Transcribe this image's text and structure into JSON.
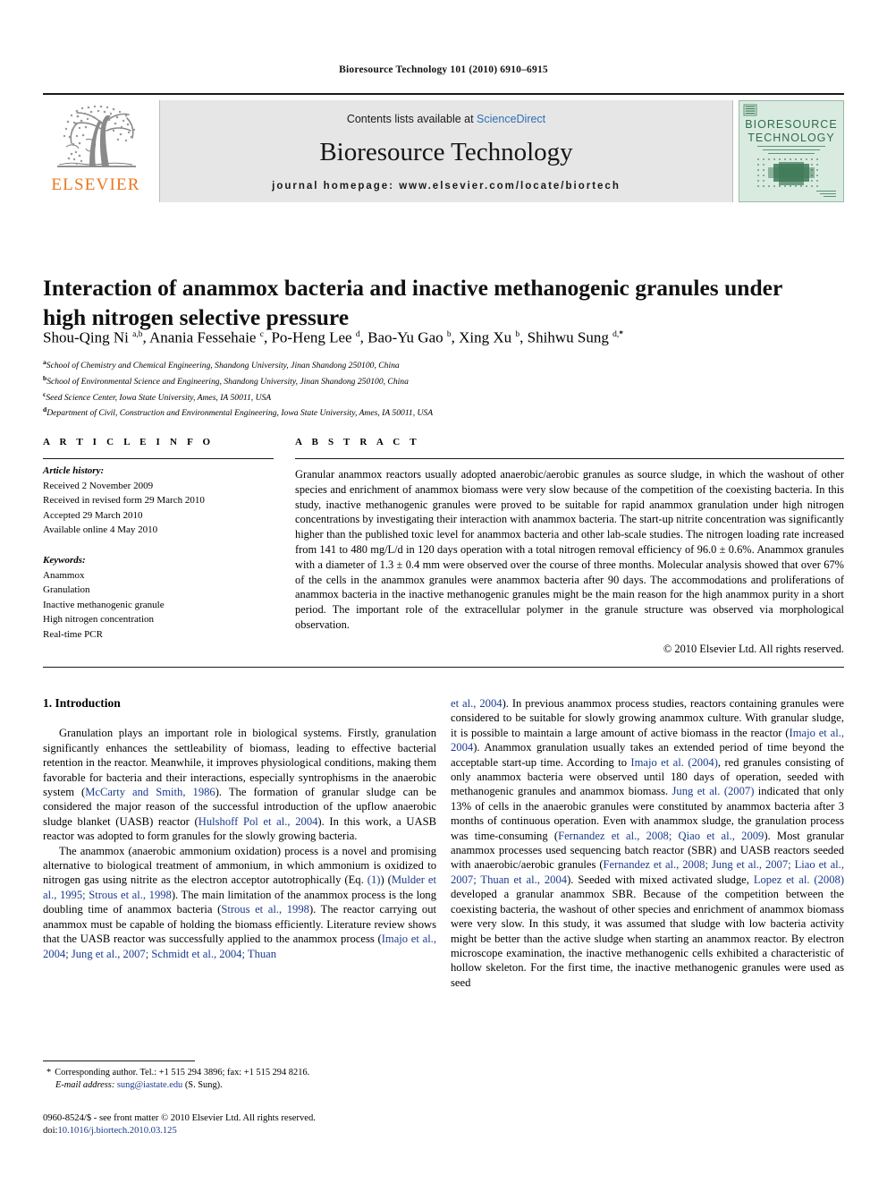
{
  "running_head": "Bioresource Technology 101 (2010) 6910–6915",
  "masthead": {
    "publisher_name": "ELSEVIER",
    "contents_prefix": "Contents lists available at ",
    "contents_link": "ScienceDirect",
    "journal_name": "Bioresource Technology",
    "homepage": "journal homepage: www.elsevier.com/locate/biortech",
    "cover_line1": "BIORESOURCE",
    "cover_line2": "TECHNOLOGY"
  },
  "article": {
    "title": "Interaction of anammox bacteria and inactive methanogenic granules under high nitrogen selective pressure",
    "authors_html": "Shou-Qing Ni <sup>a,b</sup>, Anania Fessehaie <sup>c</sup>, Po-Heng Lee <sup>d</sup>, Bao-Yu Gao <sup>b</sup>, Xing Xu <sup>b</sup>, Shihwu Sung <sup>d,<b>*</b></sup>",
    "affiliations": [
      {
        "marker": "a",
        "text": "School of Chemistry and Chemical Engineering, Shandong University, Jinan Shandong 250100, China"
      },
      {
        "marker": "b",
        "text": "School of Environmental Science and Engineering, Shandong University, Jinan Shandong 250100, China"
      },
      {
        "marker": "c",
        "text": "Seed Science Center, Iowa State University, Ames, IA 50011, USA"
      },
      {
        "marker": "d",
        "text": "Department of Civil, Construction and Environmental Engineering, Iowa State University, Ames, IA 50011, USA"
      }
    ]
  },
  "article_info": {
    "heading": "A R T I C L E   I N F O",
    "history_label": "Article history:",
    "history": [
      "Received 2 November 2009",
      "Received in revised form 29 March 2010",
      "Accepted 29 March 2010",
      "Available online 4 May 2010"
    ],
    "keywords_label": "Keywords:",
    "keywords": [
      "Anammox",
      "Granulation",
      "Inactive methanogenic granule",
      "High nitrogen concentration",
      "Real-time PCR"
    ]
  },
  "abstract": {
    "heading": "A B S T R A C T",
    "text": "Granular anammox reactors usually adopted anaerobic/aerobic granules as source sludge, in which the washout of other species and enrichment of anammox biomass were very slow because of the competition of the coexisting bacteria. In this study, inactive methanogenic granules were proved to be suitable for rapid anammox granulation under high nitrogen concentrations by investigating their interaction with anammox bacteria. The start-up nitrite concentration was significantly higher than the published toxic level for anammox bacteria and other lab-scale studies. The nitrogen loading rate increased from 141 to 480 mg/L/d in 120 days operation with a total nitrogen removal efficiency of 96.0 ± 0.6%. Anammox granules with a diameter of 1.3 ± 0.4 mm were observed over the course of three months. Molecular analysis showed that over 67% of the cells in the anammox granules were anammox bacteria after 90 days. The accommodations and proliferations of anammox bacteria in the inactive methanogenic granules might be the main reason for the high anammox purity in a short period. The important role of the extracellular polymer in the granule structure was observed via morphological observation.",
    "copyright": "© 2010 Elsevier Ltd. All rights reserved."
  },
  "body": {
    "section_number_title": "1. Introduction",
    "left_paragraphs_html": [
      "Granulation plays an important role in biological systems. Firstly, granulation significantly enhances the settleability of biomass, leading to effective bacterial retention in the reactor. Meanwhile, it improves physiological conditions, making them favorable for bacteria and their interactions, especially syntrophisms in the anaerobic system (<a class=\"ref\">McCarty and Smith, 1986</a>). The formation of granular sludge can be considered the major reason of the successful introduction of the upflow anaerobic sludge blanket (UASB) reactor (<a class=\"ref\">Hulshoff Pol et al., 2004</a>). In this work, a UASB reactor was adopted to form granules for the slowly growing bacteria.",
      "The anammox (anaerobic ammonium oxidation) process is a novel and promising alternative to biological treatment of ammonium, in which ammonium is oxidized to nitrogen gas using nitrite as the electron acceptor autotrophically (Eq. <a class=\"ref\">(1)</a>) (<a class=\"ref\">Mulder et al., 1995; Strous et al., 1998</a>). The main limitation of the anammox process is the long doubling time of anammox bacteria (<a class=\"ref\">Strous et al., 1998</a>). The reactor carrying out anammox must be capable of holding the biomass efficiently. Literature review shows that the UASB reactor was successfully applied to the anammox process (<a class=\"ref\">Imajo et al., 2004; Jung et al., 2007; Schmidt et al., 2004; Thuan</a>"
    ],
    "right_paragraphs_html": [
      "<a class=\"ref\">et al., 2004</a>). In previous anammox process studies, reactors containing granules were considered to be suitable for slowly growing anammox culture. With granular sludge, it is possible to maintain a large amount of active biomass in the reactor (<a class=\"ref\">Imajo et al., 2004</a>). Anammox granulation usually takes an extended period of time beyond the acceptable start-up time. According to <a class=\"ref\">Imajo et al. (2004)</a>, red granules consisting of only anammox bacteria were observed until 180 days of operation, seeded with methanogenic granules and anammox biomass. <a class=\"ref\">Jung et al. (2007)</a> indicated that only 13% of cells in the anaerobic granules were constituted by anammox bacteria after 3 months of continuous operation. Even with anammox sludge, the granulation process was time-consuming (<a class=\"ref\">Fernandez et al., 2008; Qiao et al., 2009</a>). Most granular anammox processes used sequencing batch reactor (SBR) and UASB reactors seeded with anaerobic/aerobic granules (<a class=\"ref\">Fernandez et al., 2008; Jung et al., 2007; Liao et al., 2007; Thuan et al., 2004</a>). Seeded with mixed activated sludge, <a class=\"ref\">Lopez et al. (2008)</a> developed a granular anammox SBR. Because of the competition between the coexisting bacteria, the washout of other species and enrichment of anammox biomass were very slow. In this study, it was assumed that sludge with low bacteria activity might be better than the active sludge when starting an anammox reactor. By electron microscope examination, the inactive methanogenic cells exhibited a characteristic of hollow skeleton. For the first time, the inactive methanogenic granules were used as seed"
    ]
  },
  "footnotes": {
    "corresponding_html": "Corresponding author. Tel.: +1 515 294 3896; fax: +1 515 294 8216.",
    "email_label": "E-mail address:",
    "email": "sung@iastate.edu",
    "email_suffix": "(S. Sung).",
    "issn_line_html": "0960-8524/$ - see front matter © 2010 Elsevier Ltd. All rights reserved.",
    "doi_label": "doi:",
    "doi_value": "10.1016/j.biortech.2010.03.125"
  },
  "colors": {
    "link_blue": "#2f6fb5",
    "ref_blue": "#1a3a8f",
    "elsevier_orange": "#E87722",
    "banner_gray": "#e6e6e6",
    "cover_green": "#d8ece0"
  }
}
